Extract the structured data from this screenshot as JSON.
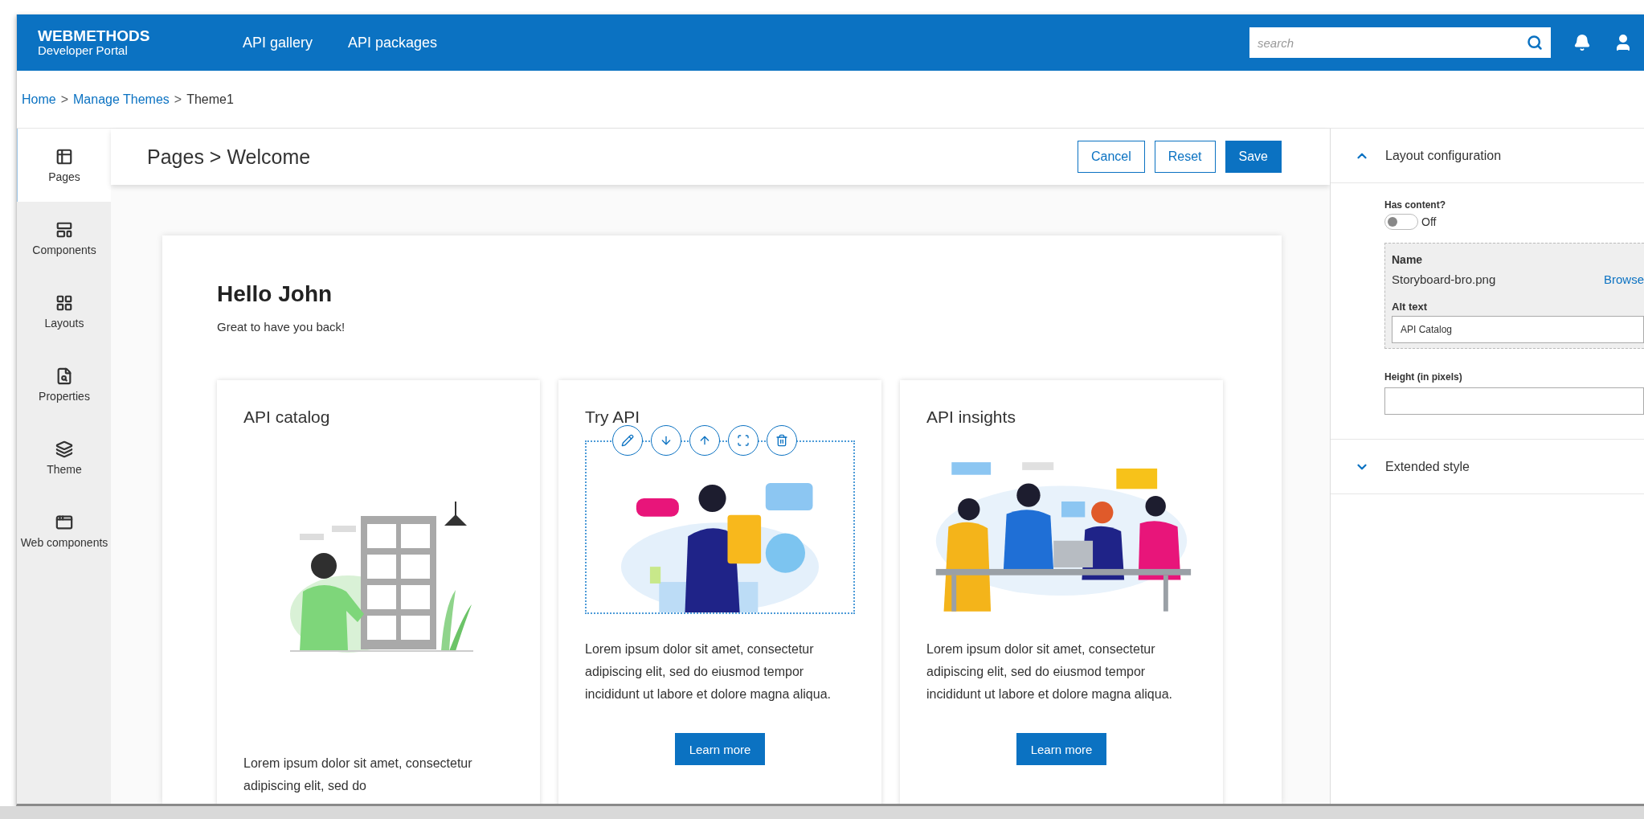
{
  "header": {
    "logo_title": "WEBMETHODS",
    "logo_subtitle": "Developer Portal",
    "nav": [
      "API gallery",
      "API packages"
    ],
    "search": {
      "placeholder": "search"
    }
  },
  "breadcrumb": {
    "separator": ">",
    "items": [
      {
        "label": "Home",
        "link": true
      },
      {
        "label": "Manage Themes",
        "link": true
      },
      {
        "label": "Theme1",
        "link": false
      }
    ]
  },
  "sidebar": {
    "items": [
      {
        "label": "Pages",
        "selected": true
      },
      {
        "label": "Components",
        "selected": false
      },
      {
        "label": "Layouts",
        "selected": false
      },
      {
        "label": "Properties",
        "selected": false
      },
      {
        "label": "Theme",
        "selected": false
      },
      {
        "label": "Web components",
        "selected": false
      }
    ]
  },
  "editor": {
    "title": "Pages > Welcome",
    "buttons": [
      {
        "label": "Cancel",
        "kind": "outline"
      },
      {
        "label": "Reset",
        "kind": "outline"
      },
      {
        "label": "Save",
        "kind": "primary"
      }
    ]
  },
  "canvas": {
    "heading": "Hello John",
    "subheading": "Great to have you back!",
    "cards": [
      {
        "title": "API catalog",
        "selected": false,
        "text": "Lorem ipsum dolor sit amet, consectetur adipiscing elit, sed do"
      },
      {
        "title": "Try API",
        "selected": true,
        "text": "Lorem ipsum dolor sit amet, consectetur adipiscing elit, sed do eiusmod tempor incididunt ut labore et dolore magna aliqua.",
        "button": "Learn more"
      },
      {
        "title": "API insights",
        "selected": false,
        "text": "Lorem ipsum dolor sit amet, consectetur adipiscing elit, sed do eiusmod tempor incididunt ut labore et dolore magna aliqua.",
        "button": "Learn more"
      }
    ]
  },
  "properties": {
    "sections": [
      {
        "title": "Layout configuration",
        "expanded": true
      },
      {
        "title": "Extended style",
        "expanded": false
      }
    ],
    "has_content": {
      "label": "Has content?",
      "on": false,
      "state_text": "Off"
    },
    "image": {
      "name_label": "Name",
      "file_name": "Storyboard-bro.png",
      "browse": "Browse",
      "alt_label": "Alt text",
      "alt_value": "API Catalog"
    },
    "height": {
      "label": "Height (in pixels)"
    }
  }
}
